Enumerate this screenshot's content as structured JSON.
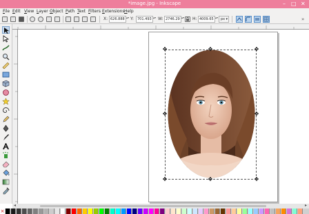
{
  "window": {
    "title": "*image.jpg - Inkscape",
    "controls": [
      "–",
      "□",
      "✕"
    ],
    "accent": "#ee7e9c"
  },
  "menu": [
    "File",
    "Edit",
    "View",
    "Layer",
    "Object",
    "Path",
    "Text",
    "Filters",
    "Extensions",
    "Help"
  ],
  "toolbar": {
    "x_label": "X:",
    "x_value": "626.888",
    "y_label": "Y:",
    "y_value": "701.493",
    "w_label": "W:",
    "w_value": "2746.29",
    "lock_icon": "lock-icon",
    "h_label": "H:",
    "h_value": "4009.65",
    "unit": "px",
    "unit_arrow": "▾",
    "spin_glyph": "▴▾",
    "toggles": [
      "scale-stroke-icon",
      "scale-corners-icon",
      "move-gradients-icon",
      "move-patterns-icon"
    ],
    "overflow": "»"
  },
  "tools": [
    "selector-tool-icon",
    "node-tool-icon",
    "tweak-tool-icon",
    "zoom-tool-icon",
    "measure-tool-icon",
    "rectangle-tool-icon",
    "box-3d-tool-icon",
    "ellipse-tool-icon",
    "star-tool-icon",
    "spiral-tool-icon",
    "pencil-tool-icon",
    "pen-tool-icon",
    "calligraphy-tool-icon",
    "text-tool-icon",
    "spray-tool-icon",
    "eraser-tool-icon",
    "paint-bucket-tool-icon",
    "gradient-tool-icon",
    "dropper-tool-icon"
  ],
  "selection": {
    "handle_glyph": "✥"
  },
  "scrollbar": {
    "left_arrow": "◂",
    "right_arrow": "▸"
  },
  "palette": {
    "none_glyph": "×",
    "colors": [
      "#000000",
      "#1a1a1a",
      "#333333",
      "#4d4d4d",
      "#666666",
      "#808080",
      "#999999",
      "#b3b3b3",
      "#cccccc",
      "#e6e6e6",
      "#ffffff",
      "#800000",
      "#ff0000",
      "#ff6600",
      "#ffcc00",
      "#ffff00",
      "#99cc00",
      "#00ff00",
      "#008000",
      "#00ffcc",
      "#00ffff",
      "#0099ff",
      "#0000ff",
      "#000080",
      "#6600ff",
      "#cc00ff",
      "#ff00ff",
      "#ff0099",
      "#800080",
      "#ffcccc",
      "#ffe6cc",
      "#ffffcc",
      "#ccffcc",
      "#ccffff",
      "#cce6ff",
      "#e6ccff",
      "#ff99cc",
      "#cc9966",
      "#996633",
      "#663300",
      "#ff9999",
      "#ffcc99",
      "#ffff99",
      "#99ff99",
      "#99ffff",
      "#99ccff",
      "#cc99ff",
      "#ff66b2",
      "#c0c0c0",
      "#f4a460",
      "#ff8c00",
      "#da70d6",
      "#7fffd4",
      "#ffa07a"
    ]
  }
}
